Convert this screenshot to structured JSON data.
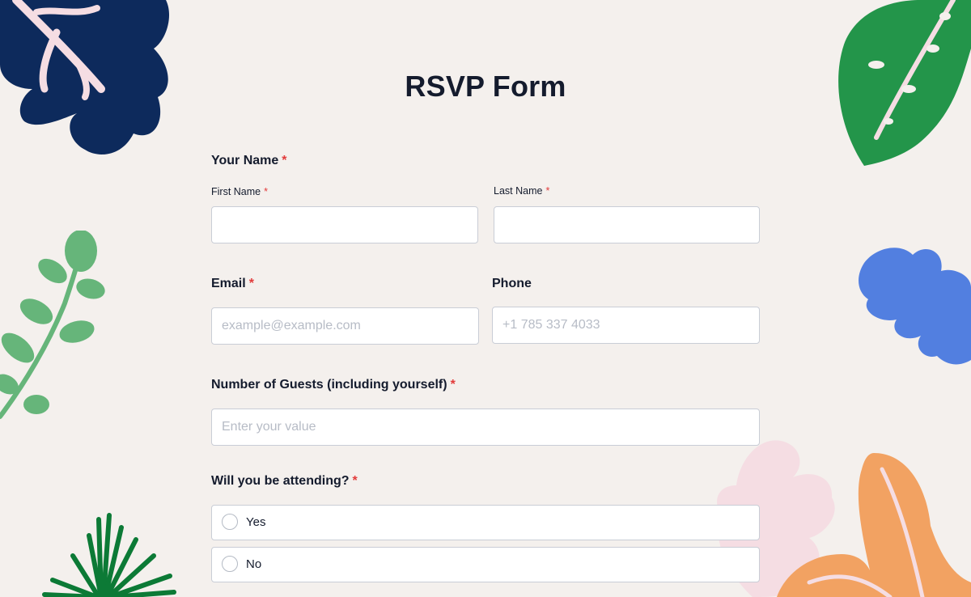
{
  "form": {
    "title": "RSVP Form",
    "required_mark": "*",
    "name": {
      "label": "Your Name",
      "first_label": "First Name",
      "first_value": "",
      "last_label": "Last Name",
      "last_value": ""
    },
    "email": {
      "label": "Email",
      "placeholder": "example@example.com",
      "value": ""
    },
    "phone": {
      "label": "Phone",
      "placeholder": "+1 785 337 4033",
      "value": ""
    },
    "guests": {
      "label": "Number of Guests (including yourself)",
      "placeholder": "Enter your value",
      "value": ""
    },
    "attending": {
      "label": "Will you be attending?",
      "options": [
        "Yes",
        "No"
      ],
      "selected": null
    }
  },
  "colors": {
    "background": "#f4f0ed",
    "required": "#e23b3b",
    "navy_leaf": "#0d2a5c",
    "green_leaf": "#23954a",
    "sage_leaf": "#66b57a",
    "blue_leaf": "#527fe0",
    "pink_leaf": "#f5dde3",
    "orange_leaf": "#f2a262",
    "dark_green_leaf": "#0c7a36"
  }
}
